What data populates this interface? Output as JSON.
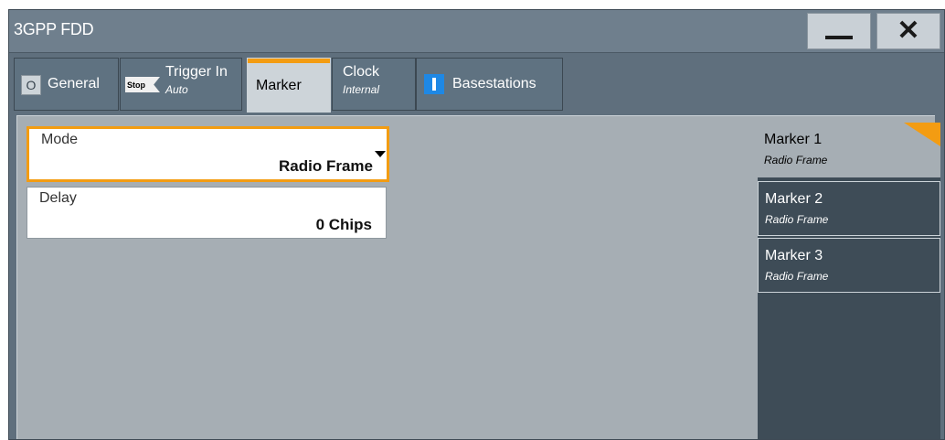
{
  "window": {
    "title": "3GPP FDD",
    "minimize_icon": "minimize-icon",
    "close_icon": "close-icon",
    "close_glyph": "✕"
  },
  "tabs": [
    {
      "label": "General",
      "icon": "O"
    },
    {
      "label": "Trigger In",
      "sublabel": "Auto",
      "icon": "Stop"
    },
    {
      "label": "Marker"
    },
    {
      "label": "Clock",
      "sublabel": "Internal"
    },
    {
      "label": "Basestations",
      "icon": "info-icon"
    }
  ],
  "active_tab": "Marker",
  "form": {
    "mode": {
      "label": "Mode",
      "value": "Radio Frame"
    },
    "delay": {
      "label": "Delay",
      "value": "0 Chips"
    }
  },
  "markers": [
    {
      "title": "Marker 1",
      "subtitle": "Radio Frame",
      "selected": true
    },
    {
      "title": "Marker 2",
      "subtitle": "Radio Frame"
    },
    {
      "title": "Marker 3",
      "subtitle": "Radio Frame"
    }
  ],
  "colors": {
    "accent": "#f39c12",
    "panel_bg": "#a6aeb4",
    "tab_bg": "#5f7281",
    "info_blue": "#1e88e5"
  }
}
